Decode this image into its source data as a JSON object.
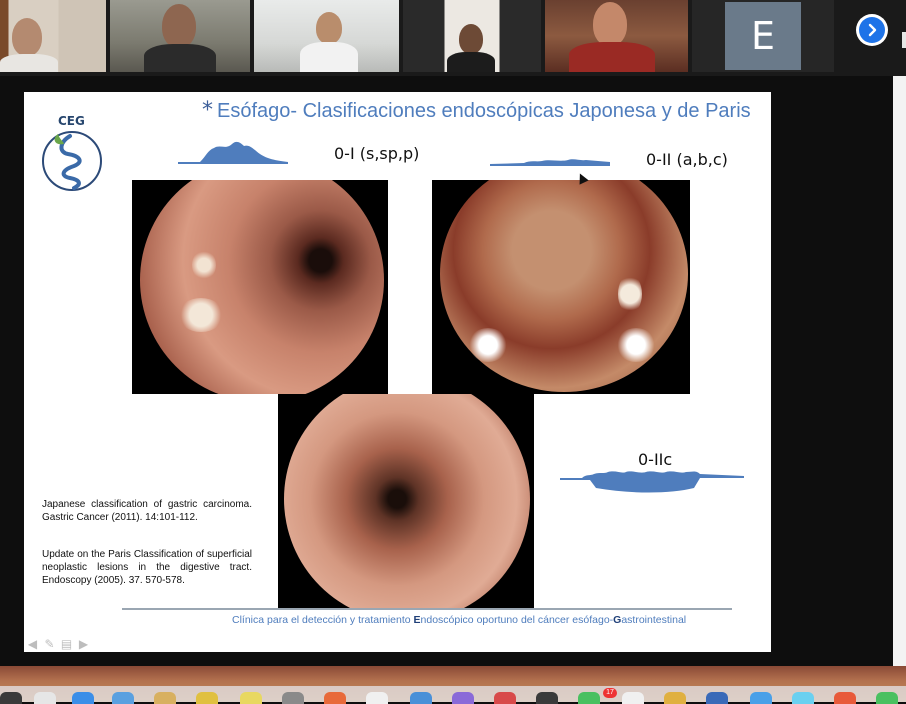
{
  "participants": {
    "avatar_letter": "E",
    "next_label": "›"
  },
  "slide": {
    "logo_text": "CEG",
    "title_star": "*",
    "title": "Esófago- Clasificaciones endoscópicas Japonesa y de Paris",
    "label_0I": "0-I (s,sp,p)",
    "label_0II": "0-II (a,b,c)",
    "label_0IIc": "0-IIc",
    "ref1": "Japanese classification of gastric carcinoma. Gastric Cancer (2011). 14:101-112.",
    "ref2": "Update on the Paris Classification of superficial neoplastic lesions in the digestive tract. Endoscopy (2005). 37. 570-578.",
    "footer": {
      "part1": "Clínica para el detección y tratamiento ",
      "bold_E": "E",
      "part2": "ndoscópico oportuno del cáncer esófago-",
      "bold_G": "G",
      "part3": "astrointestinal"
    }
  },
  "controls": [
    "prev-arrow",
    "pen",
    "menu",
    "next-arrow"
  ],
  "colors": {
    "accent": "#4f7dbd",
    "profile_fill": "#4f7dbd",
    "active_speaker": "#b8cf3c",
    "next_button": "#1e73e8"
  },
  "dock": {
    "badge_count": "17"
  }
}
